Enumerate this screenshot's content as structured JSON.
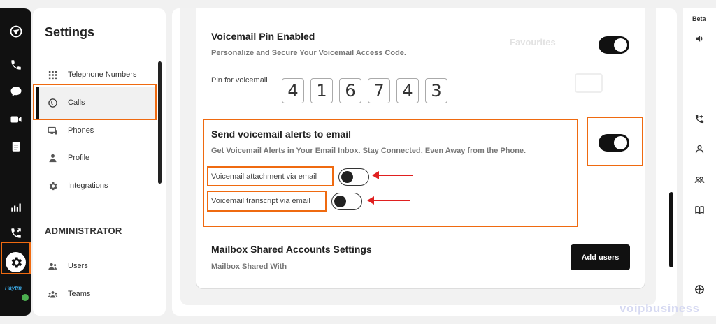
{
  "rail": {
    "icons": [
      "brand-logo-icon",
      "phone-icon",
      "chat-icon",
      "video-icon",
      "notes-icon",
      "analytics-icon",
      "call-forward-icon",
      "settings-icon"
    ],
    "paytm_label": "Paytm"
  },
  "sidebar": {
    "title": "Settings",
    "items": [
      {
        "label": "Telephone Numbers",
        "icon": "grid-dialpad-icon"
      },
      {
        "label": "Calls",
        "icon": "calls-icon"
      },
      {
        "label": "Phones",
        "icon": "monitor-phone-icon"
      },
      {
        "label": "Profile",
        "icon": "person-icon"
      },
      {
        "label": "Integrations",
        "icon": "integrations-gear-icon"
      }
    ],
    "admin_heading": "ADMINISTRATOR",
    "admin_items": [
      {
        "label": "Users",
        "icon": "users-icon"
      },
      {
        "label": "Teams",
        "icon": "teams-icon"
      }
    ]
  },
  "voicemail_pin": {
    "title": "Voicemail Pin Enabled",
    "subtitle": "Personalize and Secure Your Voicemail Access Code.",
    "pin_label": "Pin for voicemail",
    "pin_digits": [
      "4",
      "1",
      "6",
      "7",
      "4",
      "3"
    ],
    "enabled": true
  },
  "email_alerts": {
    "title": "Send voicemail alerts to email",
    "subtitle": "Get Voicemail Alerts in Your Email Inbox. Stay Connected, Even Away from the Phone.",
    "enabled": true,
    "attachment_label": "Voicemail attachment via email",
    "attachment_enabled": false,
    "transcript_label": "Voicemail transcript via email",
    "transcript_enabled": false
  },
  "mailbox": {
    "title": "Mailbox Shared Accounts Settings",
    "subtitle": "Mailbox Shared With",
    "button_label": "Add users"
  },
  "ghost": {
    "favourites": "Favourites"
  },
  "right_rail": {
    "beta_label": "Beta",
    "icons": [
      "speaker-icon",
      "phone-add-icon",
      "person-outline-icon",
      "group-icon",
      "book-icon",
      "support-icon"
    ]
  },
  "watermark": "voipbusiness",
  "colors": {
    "highlight": "#ef6a10",
    "arrow": "#e02020",
    "toggle_on": "#111111"
  }
}
